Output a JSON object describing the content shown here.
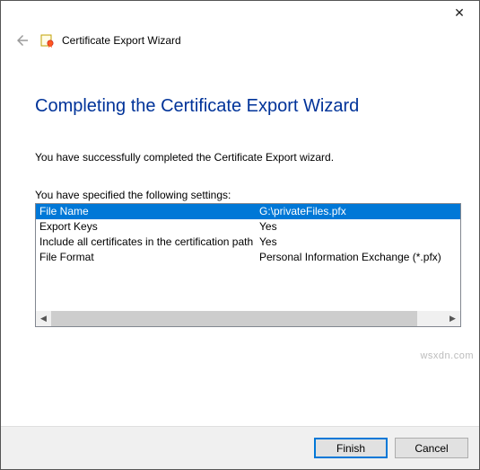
{
  "window": {
    "close_glyph": "✕"
  },
  "header": {
    "back_glyph": "←",
    "title": "Certificate Export Wizard"
  },
  "main": {
    "heading": "Completing the Certificate Export Wizard",
    "success_text": "You have successfully completed the Certificate Export wizard.",
    "settings_intro": "You have specified the following settings:",
    "rows": [
      {
        "key": "File Name",
        "value": "G:\\privateFiles.pfx",
        "selected": true
      },
      {
        "key": "Export Keys",
        "value": "Yes",
        "selected": false
      },
      {
        "key": "Include all certificates in the certification path",
        "value": "Yes",
        "selected": false
      },
      {
        "key": "File Format",
        "value": "Personal Information Exchange (*.pfx)",
        "selected": false
      }
    ],
    "scroll": {
      "left_glyph": "◀",
      "right_glyph": "▶"
    }
  },
  "footer": {
    "finish_label": "Finish",
    "cancel_label": "Cancel"
  },
  "watermark": "wsxdn.com"
}
